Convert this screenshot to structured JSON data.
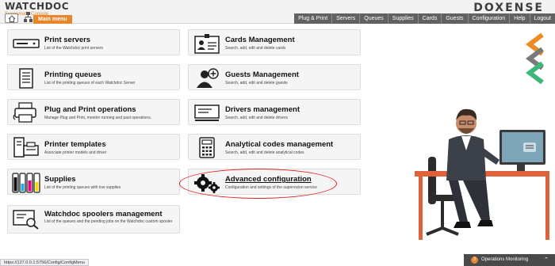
{
  "header": {
    "logo_text": "WATCHDOC",
    "logo_subtitle": "Supervision Console",
    "main_menu_label": "Main menu",
    "brand": "DOXENSE",
    "nav": [
      "Plug & Print",
      "Servers",
      "Queues",
      "Supplies",
      "Cards",
      "Guests",
      "Configuration",
      "Help",
      "Logout"
    ]
  },
  "cards": [
    {
      "title": "Print servers",
      "desc": "List of the Watchdoc print servers",
      "icon": "print-server-icon"
    },
    {
      "title": "Cards Management",
      "desc": "Search, add, edit and delete cards",
      "icon": "id-card-icon"
    },
    {
      "title": "Printing queues",
      "desc": "List of the printing queues of each Watchdoc Server",
      "icon": "printing-queue-icon"
    },
    {
      "title": "Guests Management",
      "desc": "Search, add, edit and delete guests",
      "icon": "add-guest-icon"
    },
    {
      "title": "Plug and Print operations",
      "desc": "Manage Plug and Print, monitor running and past operations.",
      "icon": "plug-print-icon"
    },
    {
      "title": "Drivers management",
      "desc": "Search, add, edit and delete drivers",
      "icon": "driver-icon"
    },
    {
      "title": "Printer templates",
      "desc": "Associate printer models and driver",
      "icon": "printer-template-icon"
    },
    {
      "title": "Analytical codes management",
      "desc": "Search, add, edit and delete analytical codes",
      "icon": "calculator-icon"
    },
    {
      "title": "Supplies",
      "desc": "List of the printing queues with low supplies",
      "icon": "supplies-icon"
    },
    {
      "title": "Advanced configuration",
      "desc": "Configuration and settings of the supervision service",
      "icon": "gears-icon"
    },
    {
      "title": "Watchdoc spoolers management",
      "desc": "List of the queues and the pending jobs on the Watchdoc custom spooler",
      "icon": "spooler-icon"
    }
  ],
  "status_url": "https://127.0.0.1:5756/Config/ConfigMenu",
  "operations": {
    "count": "3",
    "label": "Operations Monitoring"
  },
  "colors": {
    "accent": "#e8862b",
    "nav_bg": "#616161",
    "brand_green": "#3cb878",
    "brand_grey": "#7a7a7a",
    "highlight": "#e02020"
  }
}
